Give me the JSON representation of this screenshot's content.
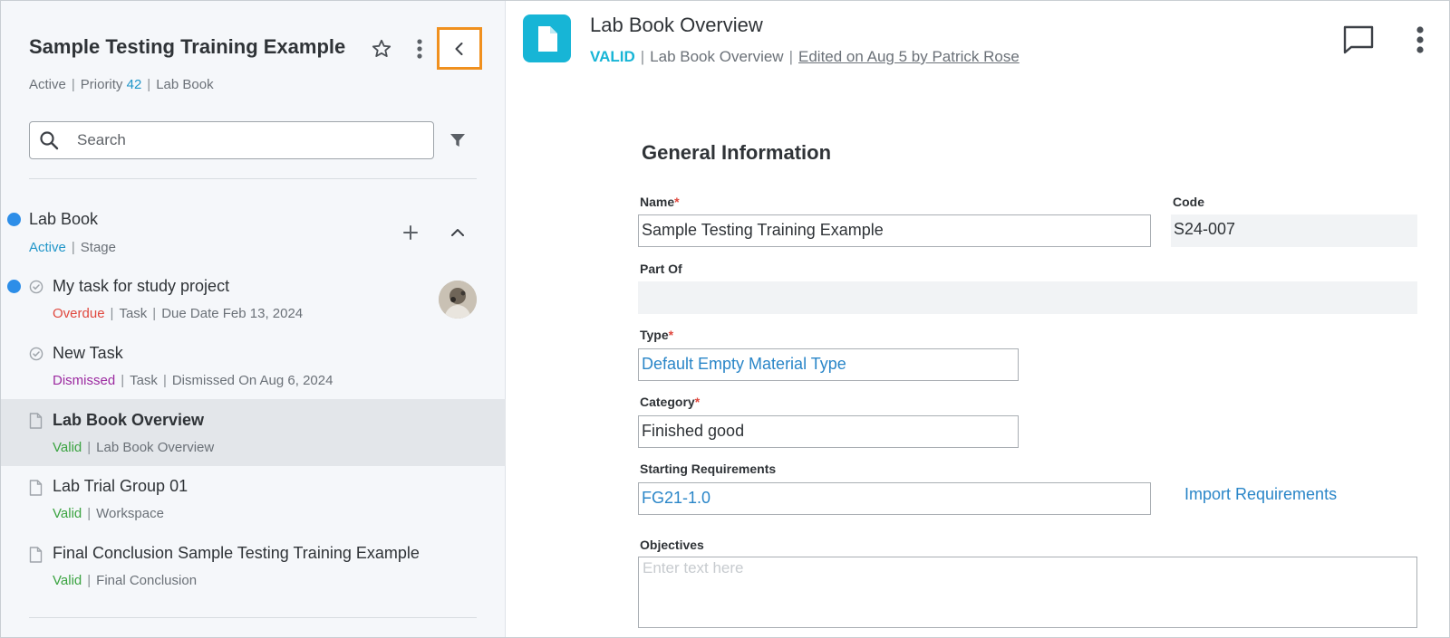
{
  "sidebar": {
    "title": "Sample Testing Training Example",
    "meta": {
      "status": "Active",
      "priority_label": "Priority",
      "priority_value": "42",
      "type": "Lab Book"
    },
    "search": {
      "placeholder": "Search"
    },
    "group": {
      "title": "Lab Book",
      "status": "Active",
      "type": "Stage"
    },
    "items": [
      {
        "title": "My task for study project",
        "status": "Overdue",
        "type": "Task",
        "extra": "Due Date Feb 13, 2024"
      },
      {
        "title": "New Task",
        "status": "Dismissed",
        "type": "Task",
        "extra": "Dismissed On Aug 6, 2024"
      },
      {
        "title": "Lab Book Overview",
        "status": "Valid",
        "type": "Lab Book Overview"
      },
      {
        "title": "Lab Trial Group 01",
        "status": "Valid",
        "type": "Workspace"
      },
      {
        "title": "Final Conclusion Sample Testing Training Example",
        "status": "Valid",
        "type": "Final Conclusion"
      }
    ]
  },
  "main": {
    "title": "Lab Book Overview",
    "status": "VALID",
    "type": "Lab Book Overview",
    "edited": "Edited on Aug 5 by Patrick Rose",
    "section_title": "General Information",
    "fields": {
      "name": {
        "label": "Name",
        "required": "*",
        "value": "Sample Testing Training Example"
      },
      "code": {
        "label": "Code",
        "value": "S24-007"
      },
      "part_of": {
        "label": "Part Of",
        "value": ""
      },
      "type": {
        "label": "Type",
        "required": "*",
        "value": "Default Empty Material Type"
      },
      "category": {
        "label": "Category",
        "required": "*",
        "value": "Finished good"
      },
      "starting_requirements": {
        "label": "Starting Requirements",
        "value": "FG21-1.0"
      },
      "objectives": {
        "label": "Objectives",
        "placeholder": "Enter text here"
      }
    },
    "import_requirements": "Import Requirements"
  },
  "colors": {
    "accent": "#17b5d6",
    "link": "#2a86c8",
    "highlight_border": "#f0901e",
    "dot": "#2d8ee8"
  },
  "icons": [
    "star-icon",
    "kebab-icon",
    "chevron-left-icon",
    "search-icon",
    "filter-icon",
    "plus-icon",
    "chevron-up-icon",
    "check-circle-icon",
    "document-icon",
    "comment-icon"
  ]
}
